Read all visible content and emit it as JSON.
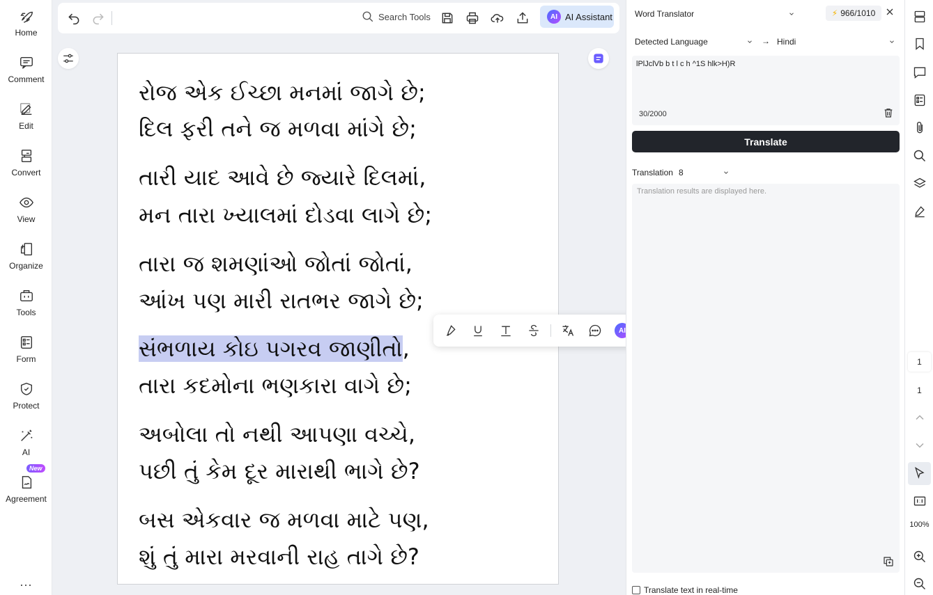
{
  "sidebar": {
    "items": [
      {
        "label": "Home",
        "icon": "rocket-icon"
      },
      {
        "label": "Comment",
        "icon": "comment-icon"
      },
      {
        "label": "Edit",
        "icon": "edit-icon"
      },
      {
        "label": "Convert",
        "icon": "convert-icon"
      },
      {
        "label": "View",
        "icon": "eye-icon"
      },
      {
        "label": "Organize",
        "icon": "organize-icon"
      },
      {
        "label": "Tools",
        "icon": "toolbox-icon"
      },
      {
        "label": "Form",
        "icon": "form-icon"
      },
      {
        "label": "Protect",
        "icon": "shield-icon"
      },
      {
        "label": "AI",
        "icon": "magic-wand-icon"
      },
      {
        "label": "Agreement",
        "icon": "agreement-icon",
        "badge": "New"
      }
    ],
    "more": "..."
  },
  "toolbar": {
    "search_label": "Search Tools",
    "ai_badge": "AI",
    "ai_assistant_label": "AI Assistant"
  },
  "document": {
    "lines": [
      "રોજ એક ઈચ્છા મનમાં જાગે છે;",
      "દિલ ફરી તને જ મળવા માંગે છે;",
      "તારી યાદ આવે છે જ્યારે દિલમાં,",
      "મન તારા ખ્યાલમાં દોડવા લાગે છે;",
      "તારા જ શમણાંઓ જોતાં જોતાં,",
      "આંખ પણ મારી રાતભર જાગે છે;",
      "સંભળાય કોઇ પગરવ જાણીતો",
      ",",
      "તારા કદમોના ભણકારા વાગે છે;",
      "અબોલા તો નથી આપણા વચ્ચે,",
      "પછી તું કેમ દૂર મારાથી ભાગે છે?",
      "બસ એકવાર જ મળવા માટે પણ,",
      "શું તું મારા મરવાની રાહ તાગે છે?"
    ],
    "highlight_color": "#c7cdf2"
  },
  "float_toolbar": {
    "ai_badge": "AI"
  },
  "translator": {
    "mode": "Word Translator",
    "credits": "966/1010",
    "source_lang": "Detected Language",
    "target_lang": "Hindi",
    "input_text": "lPlJclVb b t l c h ^1S hlk>H)R",
    "counter": "30/2000",
    "translate_button": "Translate",
    "translation_label": "Translation",
    "translation_option": "8",
    "result_placeholder": "Translation results are displayed here.",
    "realtime_label": "Translate text in real-time"
  },
  "rightbar": {
    "page_current": "1",
    "page_total": "1",
    "zoom": "100%"
  },
  "colors": {
    "accent_dark": "#22252b",
    "ai_button_bg": "#dbe8fb",
    "highlight": "#c7cdf2"
  }
}
